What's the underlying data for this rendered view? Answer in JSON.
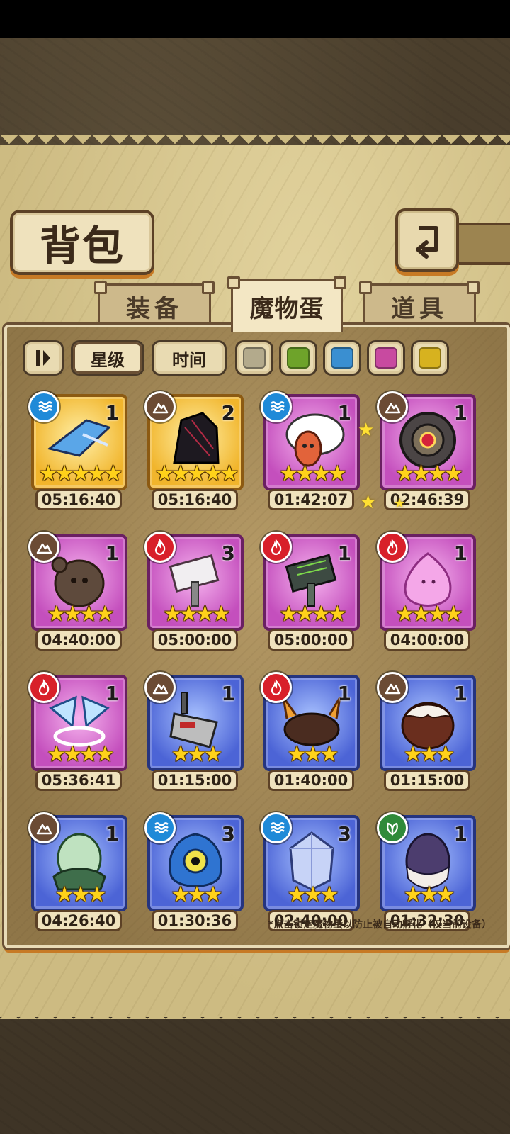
{
  "title": "背包",
  "tabs": [
    {
      "label": "装备",
      "active": false
    },
    {
      "label": "魔物蛋",
      "active": true
    },
    {
      "label": "道具",
      "active": false
    }
  ],
  "filters": {
    "sort_labels": [
      "星级",
      "时间"
    ],
    "selected_sort": "星级",
    "color_swatches": [
      "#b3aa8c",
      "#6ea32a",
      "#3a8fd1",
      "#c84aa0",
      "#d7b21f"
    ]
  },
  "eggs": [
    {
      "element": "water",
      "rarity": "gold",
      "count": "1",
      "stars": "★★★★★",
      "timer": "05:16:40",
      "art": "crystal-blade"
    },
    {
      "element": "earth",
      "rarity": "gold",
      "count": "2",
      "stars": "★★★★★",
      "timer": "05:16:40",
      "art": "dark-hood"
    },
    {
      "element": "water",
      "rarity": "purple",
      "count": "1",
      "stars": "★★★★",
      "timer": "01:42:07",
      "art": "feather-squid"
    },
    {
      "element": "earth",
      "rarity": "purple",
      "count": "1",
      "stars": "★★★★",
      "timer": "02:46:39",
      "art": "gear-eye"
    },
    {
      "element": "earth",
      "rarity": "purple",
      "count": "1",
      "stars": "★★★★",
      "timer": "04:40:00",
      "art": "mud-bear"
    },
    {
      "element": "fire",
      "rarity": "purple",
      "count": "3",
      "stars": "★★★★",
      "timer": "05:00:00",
      "art": "white-hammer"
    },
    {
      "element": "fire",
      "rarity": "purple",
      "count": "1",
      "stars": "★★★★",
      "timer": "05:00:00",
      "art": "dark-hammer"
    },
    {
      "element": "fire",
      "rarity": "purple",
      "count": "1",
      "stars": "★★★★",
      "timer": "04:00:00",
      "art": "pink-slime"
    },
    {
      "element": "fire",
      "rarity": "purple",
      "count": "1",
      "stars": "★★★★",
      "timer": "05:36:41",
      "art": "ice-wings"
    },
    {
      "element": "earth",
      "rarity": "blue",
      "count": "1",
      "stars": "★★★",
      "timer": "01:15:00",
      "art": "cleaver"
    },
    {
      "element": "fire",
      "rarity": "blue",
      "count": "1",
      "stars": "★★★",
      "timer": "01:40:00",
      "art": "spiky-beast"
    },
    {
      "element": "earth",
      "rarity": "blue",
      "count": "1",
      "stars": "★★★",
      "timer": "01:15:00",
      "art": "choco-blob"
    },
    {
      "element": "earth",
      "rarity": "blue",
      "count": "1",
      "stars": "★★★",
      "timer": "04:26:40",
      "art": "green-egg"
    },
    {
      "element": "water",
      "rarity": "blue",
      "count": "3",
      "stars": "★★★",
      "timer": "01:30:36",
      "art": "blue-cyclops"
    },
    {
      "element": "water",
      "rarity": "blue",
      "count": "3",
      "stars": "★★★",
      "timer": "02:40:00",
      "art": "crystal-egg"
    },
    {
      "element": "nature",
      "rarity": "blue",
      "count": "1",
      "stars": "★★★",
      "timer": "01:32:30",
      "art": "purple-egg"
    }
  ],
  "element_colors": {
    "water": "#1f8ad8",
    "earth": "#6b4b34",
    "fire": "#d8202a",
    "nature": "#2f8a3a"
  },
  "footnote": "*点击锁定魔物蛋以防止被自动孵化（仅当前设备）"
}
